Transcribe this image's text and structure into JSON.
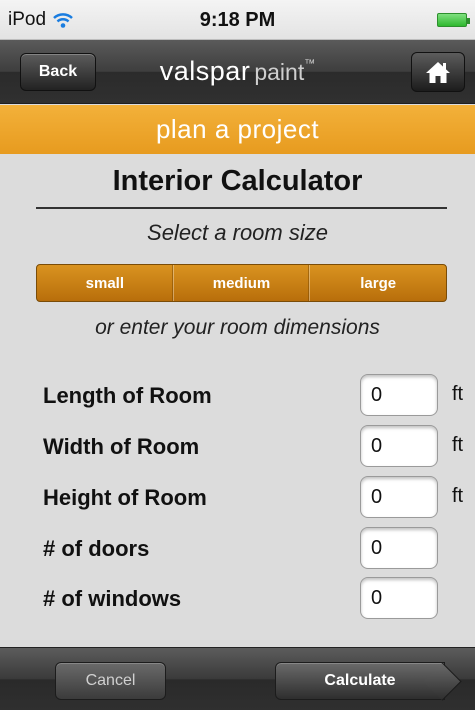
{
  "status_bar": {
    "device": "iPod",
    "time": "9:18 PM"
  },
  "nav": {
    "back_label": "Back",
    "brand_main": "valspar",
    "brand_sub": "paint",
    "brand_tm": "™",
    "home_icon": "home-icon"
  },
  "banner": {
    "text": "plan a project"
  },
  "calculator": {
    "title": "Interior Calculator",
    "subtitle": "Select a room size",
    "room_sizes": [
      "small",
      "medium",
      "large"
    ],
    "alt_text": "or enter your room dimensions"
  },
  "fields": [
    {
      "label": "Length of Room",
      "value": "0",
      "unit": "ft"
    },
    {
      "label": "Width of Room",
      "value": "0",
      "unit": "ft"
    },
    {
      "label": "Height of Room",
      "value": "0",
      "unit": "ft"
    },
    {
      "label": "# of doors",
      "value": "0",
      "unit": ""
    },
    {
      "label": "# of windows",
      "value": "0",
      "unit": ""
    }
  ],
  "toolbar": {
    "cancel_label": "Cancel",
    "calculate_label": "Calculate"
  },
  "colors": {
    "accent_orange": "#e9a127",
    "bar_dark": "#3a3a3a",
    "battery_green": "#2fb82f"
  }
}
